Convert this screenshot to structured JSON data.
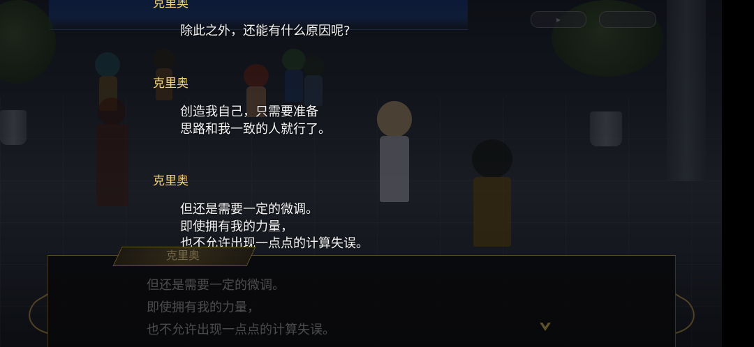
{
  "log": [
    {
      "speaker": "克里奥",
      "lines": [
        "除此之外，还能有什么原因呢?"
      ]
    },
    {
      "speaker": "克里奥",
      "lines": [
        "创造我自己，只需要准备",
        "思路和我一致的人就行了。"
      ]
    },
    {
      "speaker": "克里奥",
      "lines": [
        "但还是需要一定的微调。",
        "即使拥有我的力量，",
        "也不允许出现一点点的计算失误。"
      ]
    }
  ],
  "dialog": {
    "speaker": "克里奥",
    "lines": [
      "但还是需要一定的微调。",
      "即使拥有我的力量，",
      "也不允许出现一点点的计算失误。"
    ]
  },
  "colors": {
    "speaker": "#f0d27a",
    "text": "#f5f5f5",
    "background": "#0c0f18"
  },
  "icons": {
    "next": "chevron-down-icon"
  }
}
